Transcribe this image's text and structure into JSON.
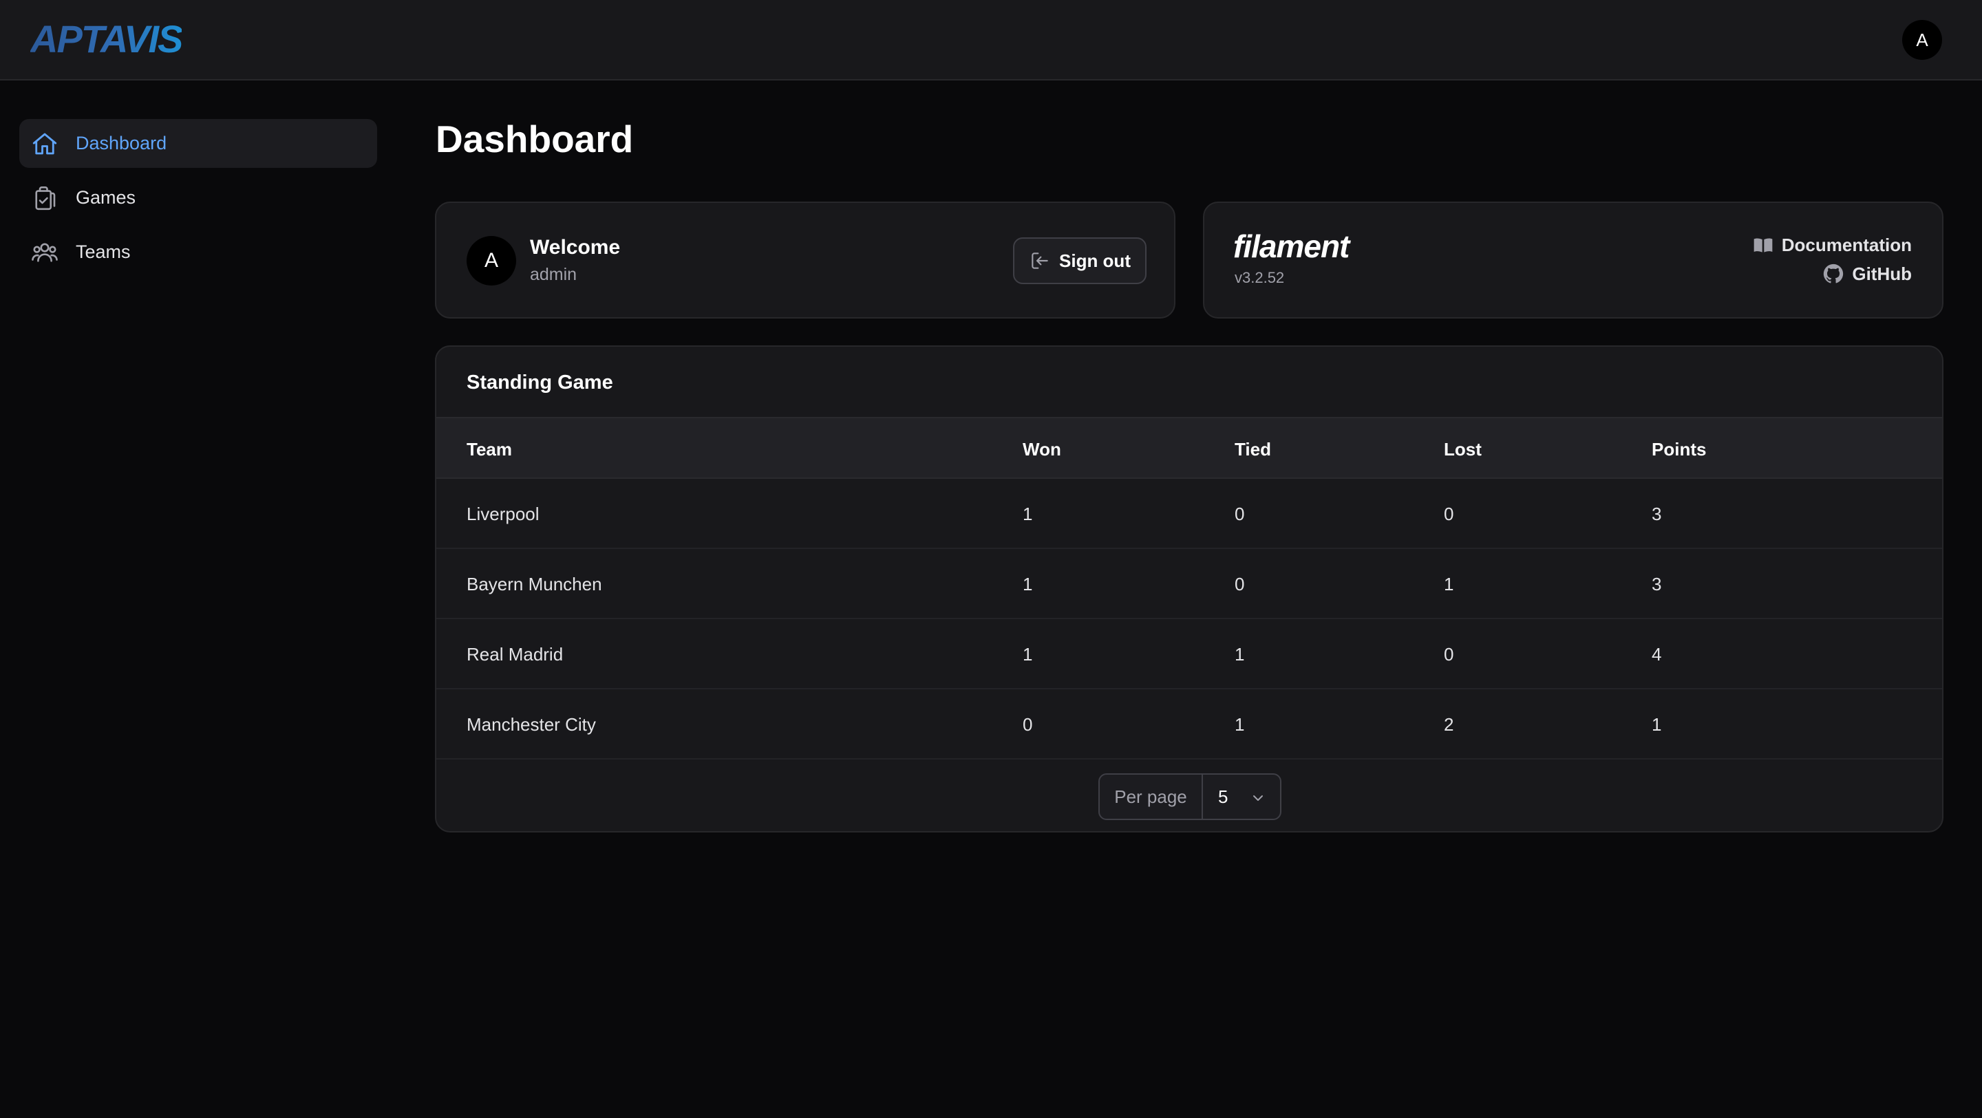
{
  "header": {
    "logo_text": "APTAVIS",
    "user_initial": "A"
  },
  "sidebar": {
    "items": [
      {
        "label": "Dashboard",
        "icon": "home-icon",
        "active": true
      },
      {
        "label": "Games",
        "icon": "clipboard-check-icon",
        "active": false
      },
      {
        "label": "Teams",
        "icon": "user-group-icon",
        "active": false
      }
    ]
  },
  "main": {
    "title": "Dashboard",
    "welcome": {
      "avatar_initial": "A",
      "title": "Welcome",
      "username": "admin",
      "signout_label": "Sign out"
    },
    "filament": {
      "brand": "filament",
      "version": "v3.2.52",
      "documentation_label": "Documentation",
      "github_label": "GitHub"
    },
    "standings": {
      "title": "Standing Game",
      "columns": [
        "Team",
        "Won",
        "Tied",
        "Lost",
        "Points"
      ],
      "rows": [
        [
          "Liverpool",
          "1",
          "0",
          "0",
          "3"
        ],
        [
          "Bayern Munchen",
          "1",
          "0",
          "1",
          "3"
        ],
        [
          "Real Madrid",
          "1",
          "1",
          "0",
          "4"
        ],
        [
          "Manchester City",
          "0",
          "1",
          "2",
          "1"
        ]
      ],
      "per_page_label": "Per page",
      "per_page_value": "5"
    }
  },
  "colors": {
    "background": "#09090b",
    "surface": "#18181b",
    "accent": "#60a5fa",
    "border": "#27272a"
  }
}
